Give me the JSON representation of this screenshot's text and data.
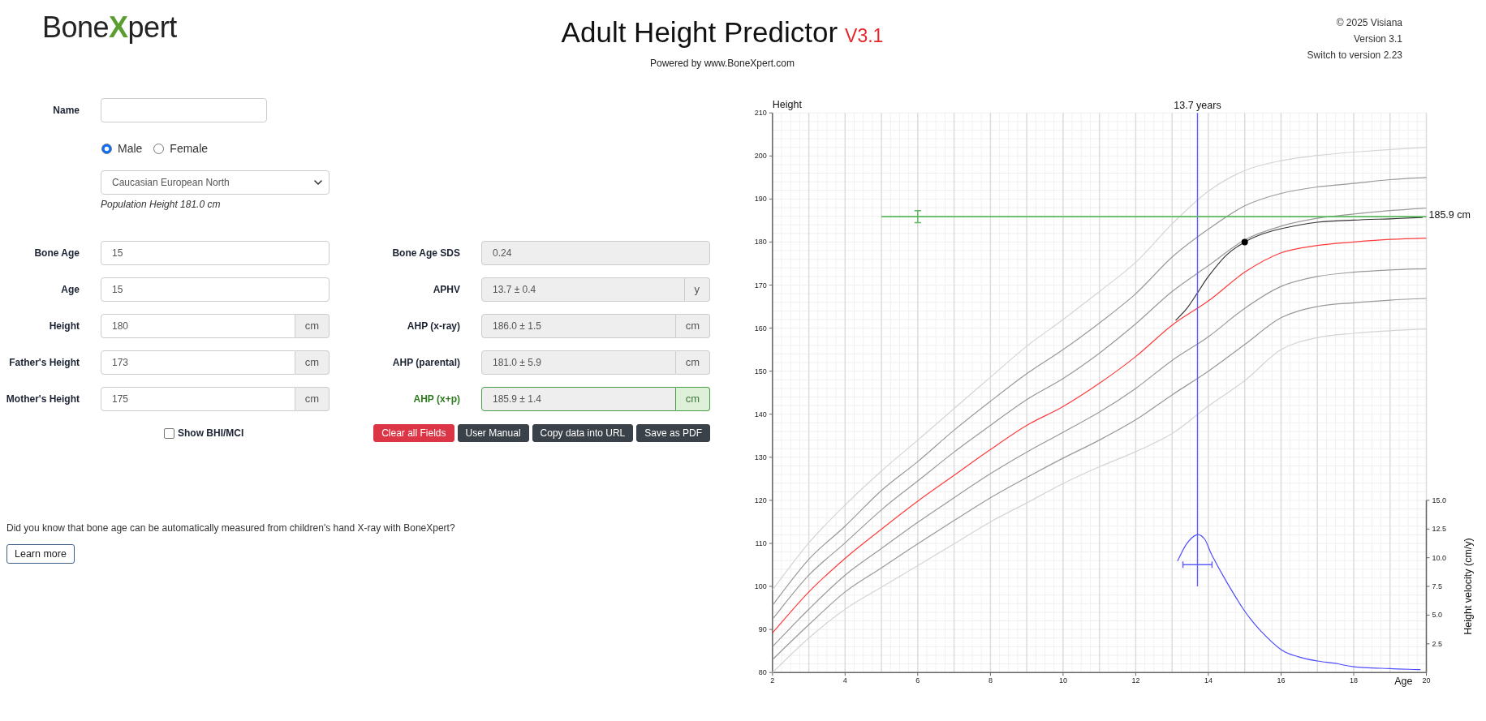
{
  "header": {
    "logo": "Bone**X**pert",
    "title": "Adult Height Predictor",
    "version": "V3.1",
    "powered_by": "Powered by www.BoneXpert.com",
    "copyright": "© 2025 Visiana",
    "version_info": "Version 3.1",
    "switch_link": "Switch to version 2.23"
  },
  "form": {
    "name_field": {
      "label": "Name"
    },
    "sex_options": [
      {
        "label": "Male",
        "selected": true
      },
      {
        "label": "Female",
        "selected": false
      }
    ],
    "population": {
      "selected": "Caucasian European North",
      "note": "Population Height 181.0 cm"
    },
    "inputs": [
      {
        "label": "Bone Age",
        "value": "15",
        "readonly": false
      },
      {
        "label": "Age",
        "value": "15",
        "readonly": false
      },
      {
        "label": "Height",
        "value": "180",
        "unit": "cm",
        "readonly": false
      },
      {
        "label": "Father's Height",
        "value": "173",
        "unit": "cm",
        "readonly": false
      },
      {
        "label": "Mother's Height",
        "value": "175",
        "unit": "cm",
        "readonly": false
      }
    ],
    "results": [
      {
        "label": "Bone Age SDS",
        "value": "0.24",
        "readonly": true,
        "highlighted": false
      },
      {
        "label": "APHV",
        "value": "13.7 ± 0.4",
        "unit": "y",
        "readonly": true,
        "highlighted": false
      },
      {
        "label": "AHP (x-ray)",
        "value": "186.0 ± 1.5",
        "unit": "cm",
        "readonly": true,
        "highlighted": false
      },
      {
        "label": "AHP (parental)",
        "value": "181.0 ± 5.9",
        "unit": "cm",
        "readonly": true,
        "highlighted": false
      },
      {
        "label": "AHP (x+p)",
        "value": "185.9 ± 1.4",
        "unit": "cm",
        "readonly": true,
        "highlighted": true
      }
    ],
    "show_bhi": {
      "label": "Show BHI/MCI",
      "checked": false
    },
    "buttons": [
      {
        "label": "Clear all Fields",
        "kind": "danger"
      },
      {
        "label": "User Manual",
        "kind": "dark"
      },
      {
        "label": "Copy data into URL",
        "kind": "dark"
      },
      {
        "label": "Save as PDF",
        "kind": "dark"
      }
    ]
  },
  "promo": {
    "text": "Did you know that bone age can be automatically measured from children's hand X-ray with BoneXpert?",
    "button": "Learn more"
  },
  "chart": {
    "chart_data": {
      "type": "line",
      "grid": true,
      "xlabel": "Age",
      "ylabel": "Height",
      "y2label": "Height velocity (cm/y)",
      "xlim": [
        2,
        20
      ],
      "ylim": [
        80,
        210
      ],
      "y2lim": [
        0,
        48.75
      ],
      "xticks": [
        2,
        4,
        6,
        8,
        10,
        12,
        14,
        16,
        18,
        20
      ],
      "yticks": [
        80,
        90,
        100,
        110,
        120,
        130,
        140,
        150,
        160,
        170,
        180,
        190,
        200,
        210
      ],
      "y2ticks": [
        {
          "value": 2.5,
          "label": "2.5"
        },
        {
          "value": 5,
          "label": "5.0"
        },
        {
          "value": 7.5,
          "label": "7.5"
        },
        {
          "value": 10,
          "label": "10.0"
        },
        {
          "value": 12.5,
          "label": "12.5"
        },
        {
          "value": 15,
          "label": "15.0"
        }
      ],
      "x": [
        2,
        3,
        4,
        5,
        6,
        7,
        8,
        9,
        10,
        11,
        12,
        13,
        14,
        15,
        16,
        17,
        18,
        19,
        20
      ],
      "series": [
        {
          "color": "#d4d4d4",
          "values": [
            99.2,
            110.1,
            118.9,
            126.8,
            134.0,
            141.3,
            148.6,
            155.8,
            162.0,
            168.5,
            175.3,
            184.2,
            191.8,
            196.6,
            198.9,
            200.1,
            200.9,
            201.5,
            202.0
          ]
        },
        {
          "color": "#999999",
          "values": [
            95.6,
            106.3,
            114.0,
            122.3,
            129.0,
            136.3,
            143.0,
            149.4,
            155.0,
            161.2,
            168.0,
            176.5,
            183.0,
            188.4,
            191.3,
            192.8,
            193.6,
            194.5,
            195.0
          ]
        },
        {
          "color": "#999999",
          "values": [
            92.4,
            102.6,
            110.1,
            117.8,
            124.5,
            131.2,
            137.4,
            143.4,
            148.3,
            154.2,
            161.0,
            168.5,
            174.5,
            180.5,
            183.7,
            185.5,
            186.5,
            187.3,
            187.9
          ]
        },
        {
          "color": "#ff3b3b",
          "values": [
            89.2,
            98.7,
            106.5,
            113.3,
            119.8,
            125.8,
            131.8,
            137.4,
            141.8,
            147.2,
            153.4,
            160.7,
            166.3,
            173.0,
            177.5,
            179.2,
            180.0,
            180.6,
            180.9
          ]
        },
        {
          "color": "#999999",
          "values": [
            86.0,
            94.7,
            102.6,
            108.8,
            114.9,
            120.6,
            126.2,
            131.2,
            135.8,
            140.5,
            146.0,
            152.5,
            158.0,
            164.6,
            169.7,
            172.0,
            173.0,
            173.5,
            173.8
          ]
        },
        {
          "color": "#999999",
          "values": [
            83.0,
            91.1,
            98.7,
            104.3,
            109.9,
            115.3,
            120.6,
            125.3,
            129.8,
            134.0,
            138.7,
            144.5,
            150.0,
            156.2,
            162.4,
            165.0,
            165.9,
            166.5,
            166.9
          ]
        },
        {
          "color": "#d4d4d4",
          "values": [
            80.0,
            88.0,
            94.7,
            99.8,
            104.8,
            109.9,
            115.0,
            119.4,
            123.9,
            127.8,
            131.3,
            135.5,
            141.9,
            147.8,
            155.0,
            157.8,
            158.8,
            159.4,
            159.8
          ]
        },
        {
          "color": "#333333",
          "x": [
            13.1,
            13.4,
            13.7,
            14.0,
            14.5,
            15.0,
            15.5,
            16.0,
            17.0,
            18.0,
            19.0,
            19.9
          ],
          "values": [
            161.8,
            164.5,
            168.2,
            172.0,
            177.0,
            180.0,
            181.9,
            183.1,
            184.6,
            185.1,
            185.4,
            185.7
          ]
        },
        {
          "axis": "y2",
          "color": "#4d4dff",
          "x": [
            13.15,
            13.4,
            13.68,
            13.9,
            14.1,
            14.5,
            15.0,
            15.43,
            16.0,
            16.5,
            17.0,
            17.5,
            18.0,
            19.0,
            19.84
          ],
          "values": [
            9.7,
            11.2,
            12.0,
            11.6,
            10.2,
            7.9,
            5.35,
            3.67,
            2.0,
            1.35,
            1.0,
            0.8,
            0.5,
            0.34,
            0.25
          ]
        },
        {
          "name": "13.7 years",
          "axis": "y2",
          "color": "#5c5cff",
          "x": [
            13.7,
            13.7,
            13.7
          ],
          "values": [
            48.75,
            9.4,
            7.5
          ],
          "xerrors": [
            null,
            0.4,
            null
          ]
        },
        {
          "name": "185.9 cm",
          "color": "#5cb85c",
          "x": [
            5,
            6,
            20
          ],
          "values": [
            185.9,
            185.9,
            185.9
          ],
          "errors": [
            null,
            1.4,
            null
          ]
        },
        {
          "color": "#000000",
          "marker": "circle",
          "x": [
            15
          ],
          "values": [
            180
          ]
        }
      ]
    }
  }
}
